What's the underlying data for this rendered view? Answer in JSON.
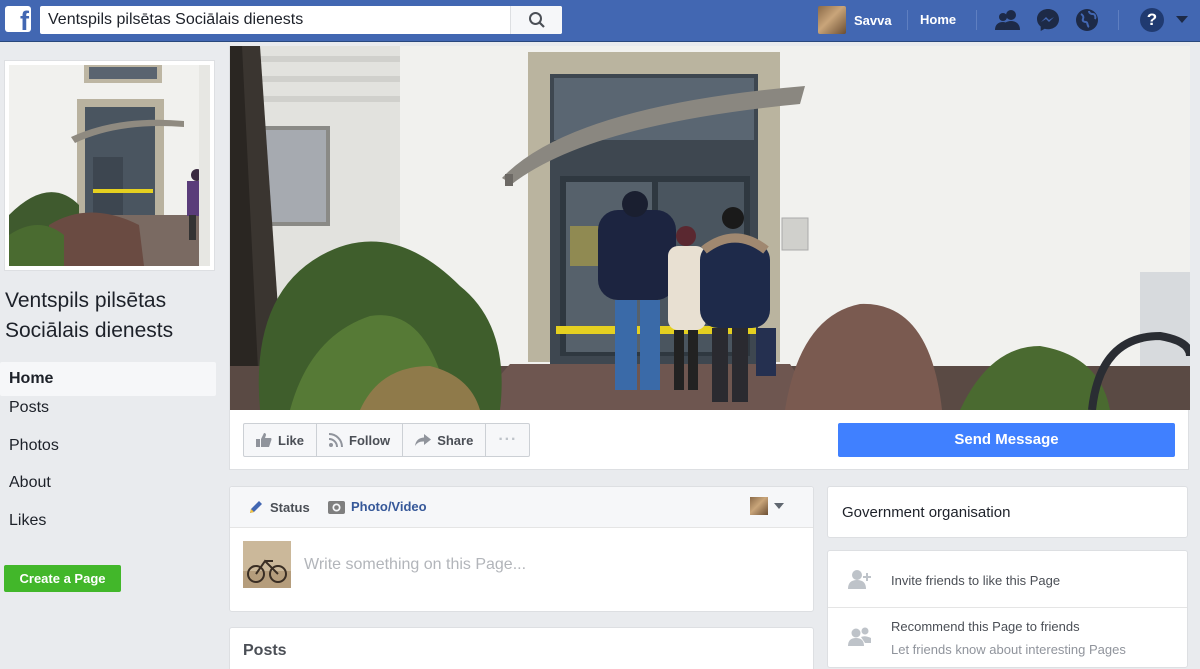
{
  "topbar": {
    "logo_letter": "f",
    "search_value": "Ventspils pilsētas Sociālais dienests",
    "profile_name": "Savva",
    "home_label": "Home",
    "help_glyph": "?",
    "icons": [
      "friend-requests-icon",
      "messenger-icon",
      "notifications-globe-icon",
      "help-icon",
      "caret-down-icon"
    ],
    "bar_color": "#4267b2"
  },
  "page": {
    "name": "Ventspils pilsētas Sociālais dienests"
  },
  "left_nav": {
    "items": [
      {
        "label": "Home",
        "active": true
      },
      {
        "label": "Posts"
      },
      {
        "label": "Photos"
      },
      {
        "label": "About"
      },
      {
        "label": "Likes"
      }
    ],
    "create_page_label": "Create a Page"
  },
  "actions": {
    "like_label": "Like",
    "follow_label": "Follow",
    "share_label": "Share",
    "more_label": "···",
    "send_message_label": "Send Message"
  },
  "composer": {
    "status_label": "Status",
    "photo_video_label": "Photo/Video",
    "placeholder": "Write something on this Page..."
  },
  "posts": {
    "title": "Posts"
  },
  "sidebar": {
    "category": "Government organisation",
    "invite_label": "Invite friends to like this Page",
    "recommend_label": "Recommend this Page to friends",
    "recommend_sub": "Let friends know about interesting Pages"
  },
  "colors": {
    "brand_blue": "#4267b2",
    "send_button": "#4080ff",
    "create_page_green": "#42b72a",
    "background": "#e9ebee"
  }
}
